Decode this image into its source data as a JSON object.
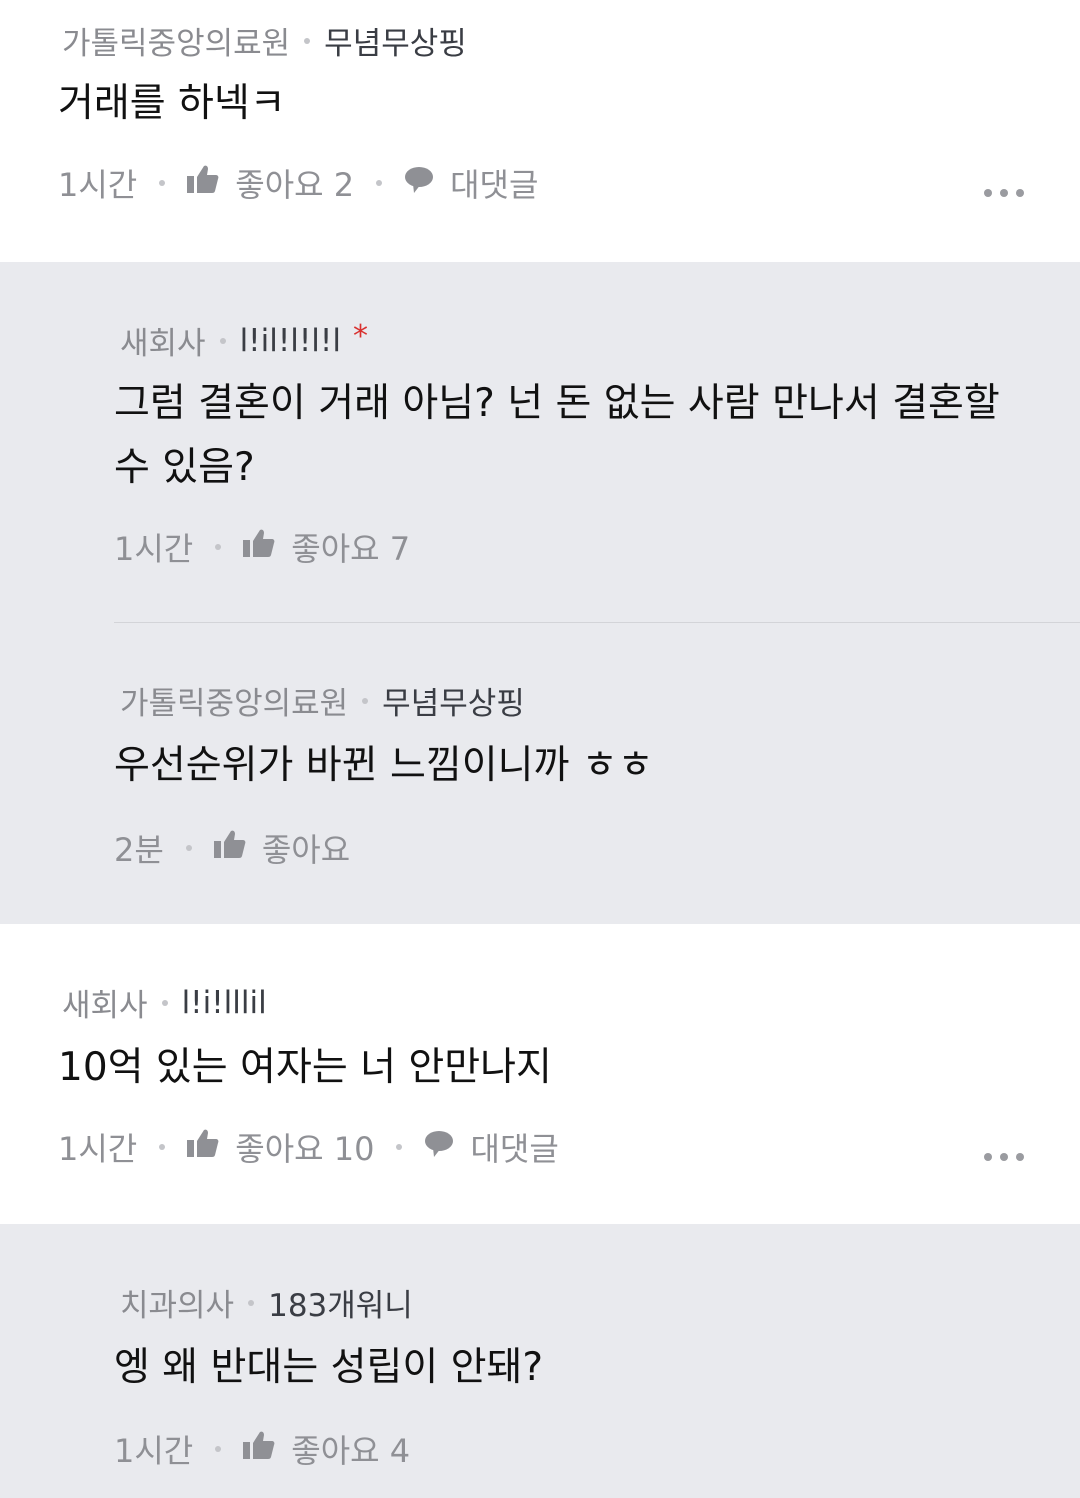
{
  "comments": [
    {
      "company": "가톨릭중앙의료원",
      "nickname": "무념무상핑",
      "text": "거래를 하넥ㅋ",
      "time": "1시간",
      "like_label": "좋아요 2",
      "reply_label": "대댓글"
    },
    {
      "company": "새회사",
      "nickname": "l!il!l!l!l",
      "mark": "*",
      "text": "그럼 결혼이 거래 아님? 넌 돈 없는 사람 만나서 결혼할 수 있음?",
      "time": "1시간",
      "like_label": "좋아요 7"
    },
    {
      "company": "가톨릭중앙의료원",
      "nickname": "무념무상핑",
      "text": "우선순위가 바뀐 느낌이니까 ㅎㅎ",
      "time": "2분",
      "like_label": "좋아요"
    },
    {
      "company": "새회사",
      "nickname": "l!i!lllil",
      "text": "10억 있는 여자는 너 안만나지",
      "time": "1시간",
      "like_label": "좋아요 10",
      "reply_label": "대댓글"
    },
    {
      "company": "치과의사",
      "nickname": "183개워니",
      "text": "엥 왜 반대는 성립이 안돼?",
      "time": "1시간",
      "like_label": "좋아요 4"
    }
  ],
  "icons": {
    "like": "thumbs-up-icon",
    "reply": "speech-bubble-icon",
    "more": "more-dots-icon"
  },
  "colors": {
    "reply_background": "#e9eaee",
    "meta_gray": "#8a8b90",
    "nickname": "#3a3d44",
    "mark_red": "#d9312f"
  }
}
